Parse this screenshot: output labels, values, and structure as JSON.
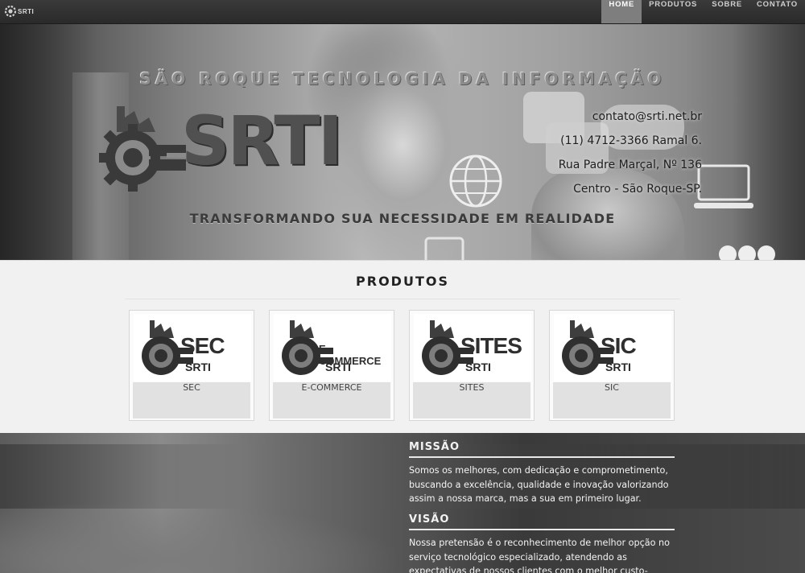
{
  "nav": {
    "brand_text": "SRTI",
    "items": [
      {
        "label": "HOME",
        "active": true
      },
      {
        "label": "PRODUTOS",
        "active": false
      },
      {
        "label": "SOBRE",
        "active": false
      },
      {
        "label": "CONTATO",
        "active": false
      }
    ]
  },
  "hero": {
    "title": "SÃO ROQUE TECNOLOGIA DA INFORMAÇÃO",
    "logo_text": "SRTI",
    "tagline": "TRANSFORMANDO SUA NECESSIDADE EM REALIDADE",
    "contact": {
      "email": "contato@srti.net.br",
      "phone": "(11) 4712-3366 Ramal 6.",
      "address": "Rua Padre Marçal, Nº 136",
      "city": "Centro - São Roque-SP."
    }
  },
  "produtos": {
    "title": "PRODUTOS",
    "items": [
      {
        "logo": "SEC",
        "logo_sub": "SRTI",
        "label": "SEC"
      },
      {
        "logo": "E-COMMERCE",
        "logo_sub": "SRTI",
        "label": "E-COMMERCE"
      },
      {
        "logo": "SITES",
        "logo_sub": "SRTI",
        "label": "SITES"
      },
      {
        "logo": "SIC",
        "logo_sub": "SRTI",
        "label": "SIC"
      }
    ]
  },
  "missao": {
    "heading": "MISSÃO",
    "lines": [
      "Somos os melhores, com dedicação e comprometimento,",
      "buscando a excelência, qualidade e inovação valorizando",
      "assim a nossa marca, mas a sua em primeiro lugar."
    ]
  },
  "visao": {
    "heading": "VISÃO",
    "lines": [
      "Nossa pretensão é o reconhecimento de melhor opção no",
      "serviço tecnológico especializado, atendendo as",
      "expectativas de nossos clientes com o melhor custo-"
    ]
  }
}
